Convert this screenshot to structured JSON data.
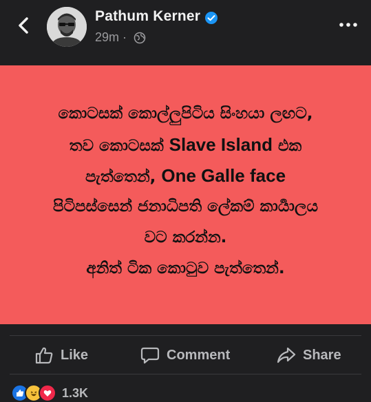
{
  "header": {
    "back_icon": "chevron-left-icon",
    "author_name": "Pathum Kerner",
    "verified_icon": "verified-badge-icon",
    "timestamp": "29m",
    "separator": "·",
    "privacy_icon": "globe-icon",
    "more_icon": "more-options-icon"
  },
  "post": {
    "background_color": "#f45b5b",
    "lines": [
      {
        "parts": [
          "කොටසක් කොල්ලුපිටිය සිංහයා ලඟට,"
        ]
      },
      {
        "parts": [
          "තව කොටසක් ",
          "Slave Island",
          " එක"
        ]
      },
      {
        "parts": [
          "පැත්තෙන්, ",
          "One Galle face"
        ]
      },
      {
        "parts": [
          "පිටිපස්සෙන් ජනාධිපති ලේකම් කාර්‍යාලය"
        ]
      },
      {
        "parts": [
          "වට කරන්න."
        ]
      },
      {
        "parts": [
          "අනිත් ටික කොටුව පැත්තෙන්."
        ]
      }
    ]
  },
  "actions": {
    "like_label": "Like",
    "comment_label": "Comment",
    "share_label": "Share",
    "like_icon": "thumbs-up-icon",
    "comment_icon": "comment-bubble-icon",
    "share_icon": "share-arrow-icon"
  },
  "reactions": {
    "icons": [
      "like-reaction-icon",
      "haha-reaction-icon",
      "love-reaction-icon"
    ],
    "count": "1.3K"
  }
}
